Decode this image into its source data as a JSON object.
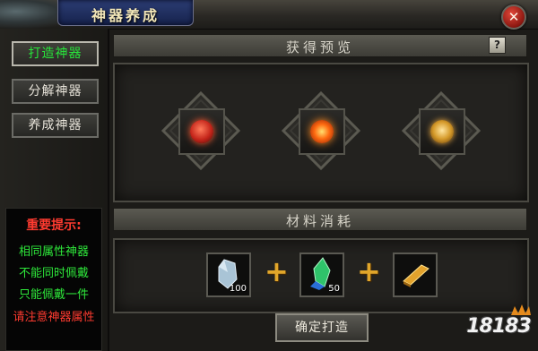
{
  "title": "神器养成",
  "close_glyph": "✕",
  "tabs": [
    {
      "label": "打造神器",
      "active": true
    },
    {
      "label": "分解神器",
      "active": false
    },
    {
      "label": "养成神器",
      "active": false
    }
  ],
  "tips": {
    "heading": "重要提示:",
    "lines": [
      "相同属性神器",
      "不能同时佩戴",
      "只能佩戴一件"
    ],
    "warning": "请注意神器属性"
  },
  "preview": {
    "heading": "获得预览",
    "help_label": "?",
    "items": [
      {
        "icon": "red-feather-gem-icon"
      },
      {
        "icon": "fire-flower-gem-icon"
      },
      {
        "icon": "golden-treasure-gem-icon"
      }
    ]
  },
  "materials": {
    "heading": "材料消耗",
    "items": [
      {
        "icon": "silver-crystal-icon",
        "count": "100"
      },
      {
        "icon": "green-blue-crystal-icon",
        "count": "50"
      },
      {
        "icon": "gold-bar-icon",
        "count": ""
      }
    ],
    "plus_glyph": "+"
  },
  "confirm_label": "确定打造",
  "watermark": "18183",
  "colors": {
    "active_tab": "#27e53a",
    "warning": "#ff3b30",
    "tip_heading": "#ff3b30",
    "tip_text": "#2ee63a",
    "plus": "#e1a62a"
  }
}
